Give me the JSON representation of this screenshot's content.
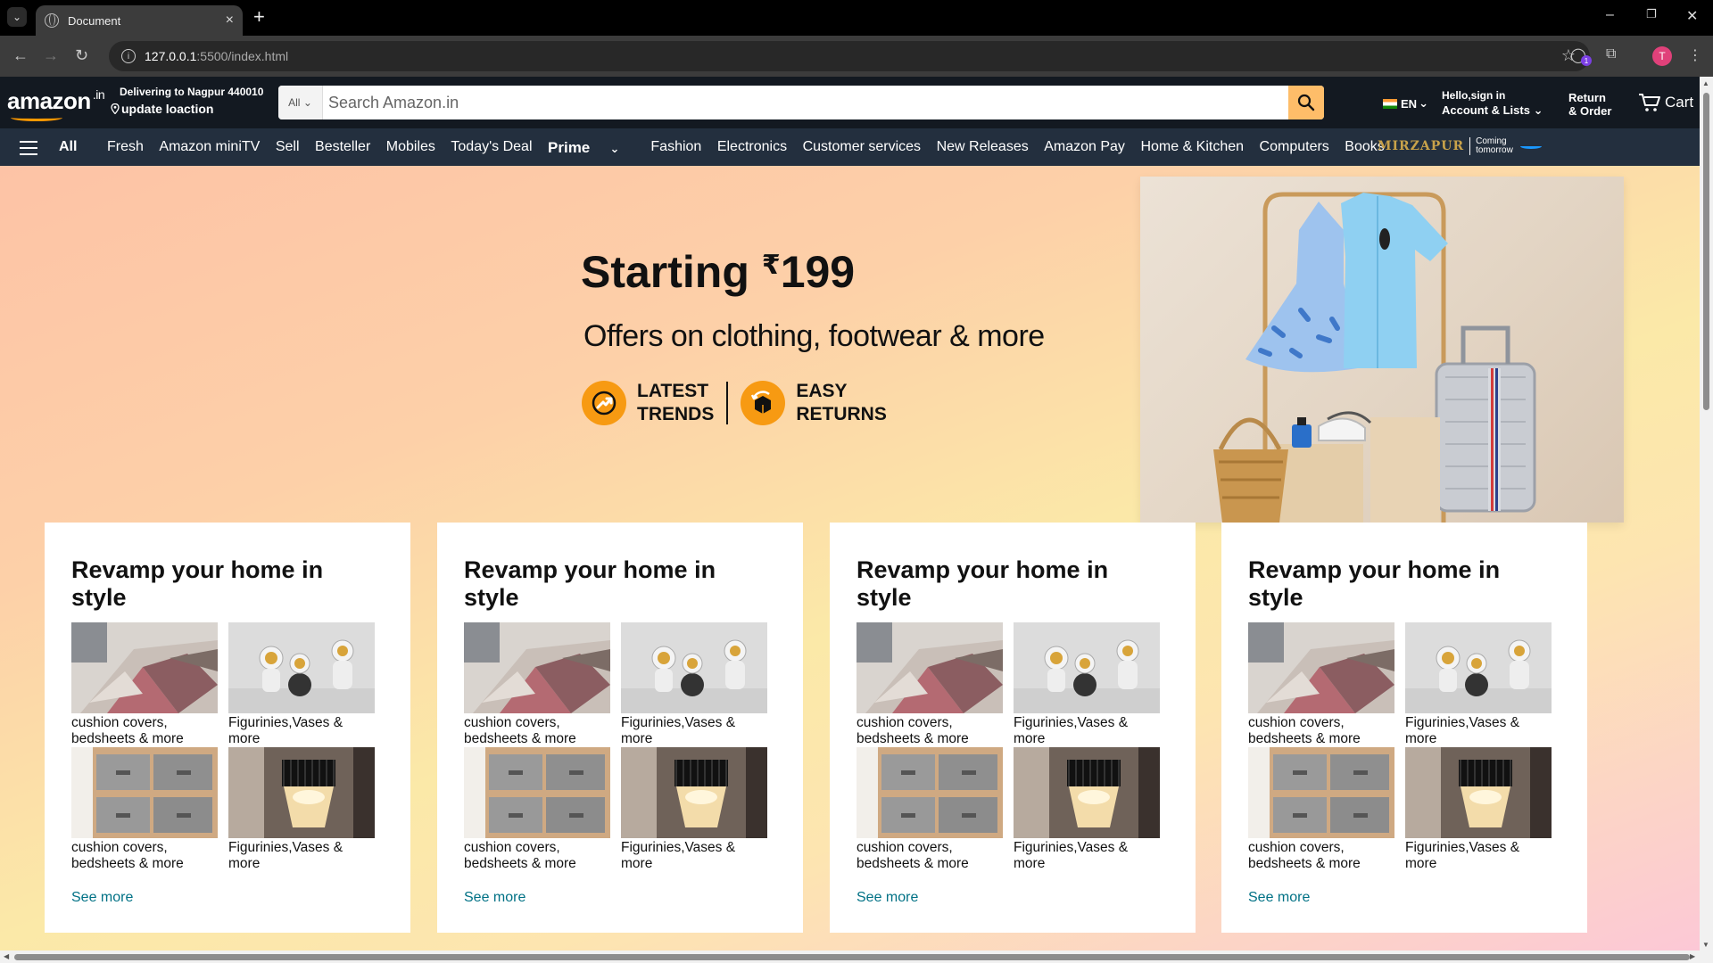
{
  "browser": {
    "tab_title": "Document",
    "url_host": "127.0.0.1",
    "url_path": ":5500/index.html",
    "profile_initial": "T",
    "ext_badge": "1"
  },
  "header": {
    "logo": "amazon",
    "logo_tld": ".in",
    "deliver_line1": "Delivering to Nagpur 440010",
    "deliver_line2": "update loaction",
    "search_category": "All",
    "search_placeholder": "Search Amazon.in",
    "language": "EN",
    "account_line1": "Hello,sign in",
    "account_line2": "Account & Lists",
    "returns_line1": "Return",
    "returns_line2": "& Order",
    "cart_label": "Cart"
  },
  "nav": {
    "all_label": "All",
    "items": [
      "Fresh",
      "Amazon miniTV",
      "Sell",
      "Besteller",
      "Mobiles",
      "Today's Deal",
      "Prime",
      "Fashion",
      "Electronics",
      "Customer services",
      "New Releases",
      "Amazon Pay",
      "Home & Kitchen",
      "Computers",
      "Books"
    ],
    "promo_title": "MIRZAPUR",
    "promo_line1": "Coming",
    "promo_line2": "tomorrow"
  },
  "hero": {
    "title": "Starting",
    "currency": "₹",
    "price": "199",
    "subtitle": "Offers on clothing, footwear & more",
    "badge1_line1": "LATEST",
    "badge1_line2": "TRENDS",
    "badge2_line1": "EASY",
    "badge2_line2": "RETURNS"
  },
  "cards": [
    {
      "title": "Revamp your home in style",
      "tiles": [
        "cushion covers, bedsheets & more",
        "Figurinies,Vases & more",
        "cushion covers, bedsheets & more",
        "Figurinies,Vases & more"
      ],
      "see_more": "See more"
    },
    {
      "title": "Revamp your home in style",
      "tiles": [
        "cushion covers, bedsheets & more",
        "Figurinies,Vases & more",
        "cushion covers, bedsheets & more",
        "Figurinies,Vases & more"
      ],
      "see_more": "See more"
    },
    {
      "title": "Revamp your home in style",
      "tiles": [
        "cushion covers, bedsheets & more",
        "Figurinies,Vases & more",
        "cushion covers, bedsheets & more",
        "Figurinies,Vases & more"
      ],
      "see_more": "See more"
    },
    {
      "title": "Revamp your home in style",
      "tiles": [
        "cushion covers, bedsheets & more",
        "Figurinies,Vases & more",
        "cushion covers, bedsheets & more",
        "Figurinies,Vases & more"
      ],
      "see_more": "See more"
    }
  ],
  "colors": {
    "header_bg": "#131921",
    "nav_bg": "#232f3e",
    "search_button": "#febd69",
    "link": "#007185",
    "badge_orange": "#f79a12"
  }
}
